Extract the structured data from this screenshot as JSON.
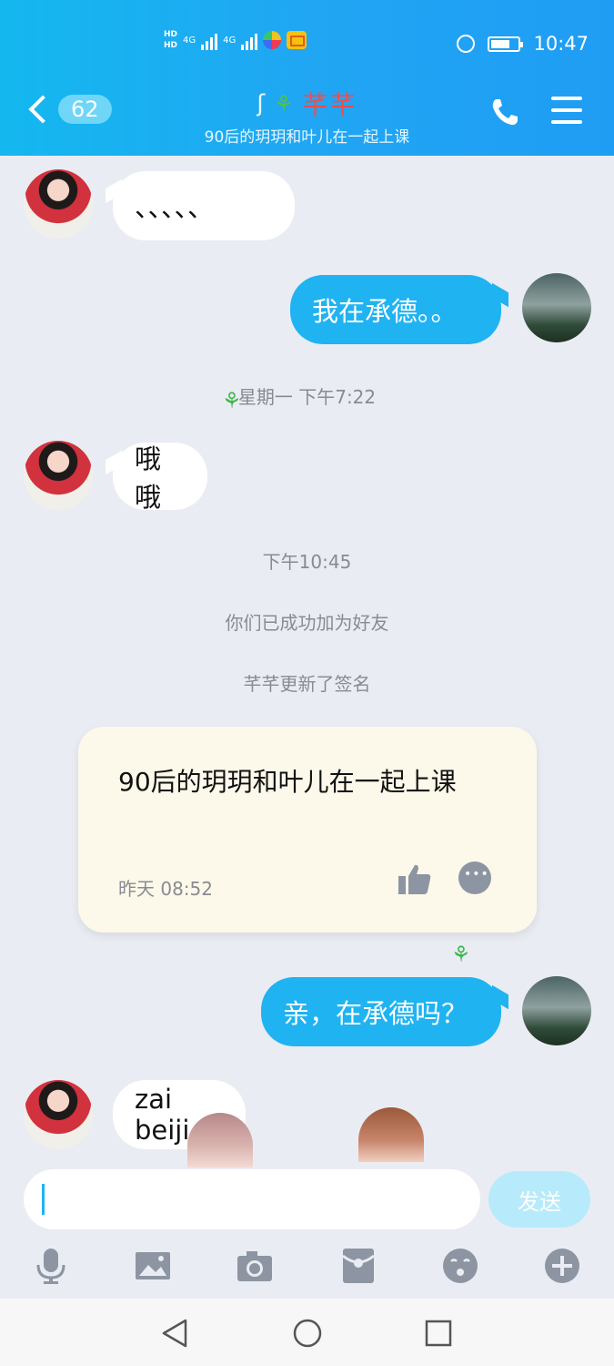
{
  "status_bar": {
    "network_1": "4G",
    "network_2": "4G",
    "time": "10:47"
  },
  "header": {
    "back_count": "62",
    "contact_name": "芊芊",
    "subtitle": "90后的玥玥和叶儿在一起上课"
  },
  "messages": [
    {
      "type": "in",
      "text": "、、、、、"
    },
    {
      "type": "out",
      "text": "我在承德。。"
    },
    {
      "type": "time",
      "text": "星期一 下午7:22"
    },
    {
      "type": "in",
      "text": "哦哦"
    },
    {
      "type": "time",
      "text": "下午10:45"
    },
    {
      "type": "system",
      "text": "你们已成功加为好友"
    },
    {
      "type": "system",
      "text": "芊芊更新了签名"
    },
    {
      "type": "out",
      "text": "亲，在承德吗？"
    },
    {
      "type": "in",
      "text": "zai beiji"
    }
  ],
  "signature_card": {
    "text": "90后的玥玥和叶儿在一起上课",
    "time": "昨天 08:52"
  },
  "input": {
    "value": "",
    "send_label": "发送"
  },
  "toolbar_icons": [
    "microphone-icon",
    "image-icon",
    "camera-icon",
    "red-packet-icon",
    "emoji-icon",
    "plus-icon"
  ],
  "colors": {
    "header": "#1fa9f2",
    "bubble_out": "#1fb3f2",
    "contact_name": "#f44b4b",
    "chat_bg": "#eaecf3"
  }
}
